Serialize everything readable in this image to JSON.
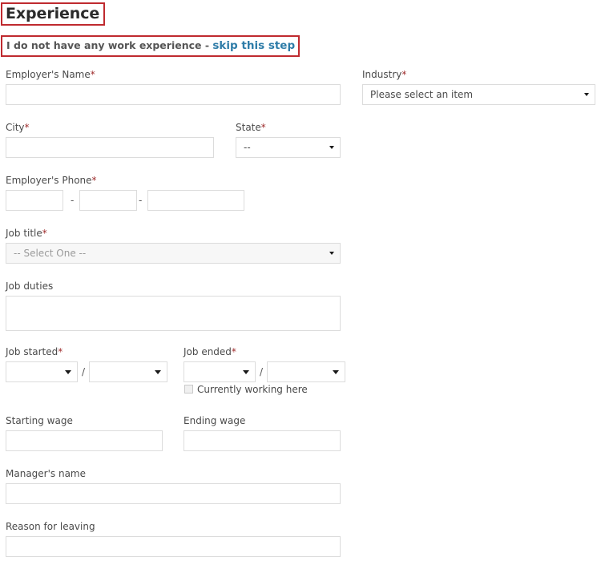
{
  "page": {
    "title": "Experience",
    "highlight_color": "#bf2a2f",
    "link_color": "#2e7ca8",
    "required_marker": "*"
  },
  "skip_banner": {
    "text": "I do not have any work experience - ",
    "link_label": "skip this step"
  },
  "form": {
    "employer_name": {
      "label": "Employer's Name",
      "required": "*",
      "value": "",
      "placeholder": ""
    },
    "industry": {
      "label": "Industry",
      "required": "*",
      "selected": "Please select an item"
    },
    "city": {
      "label": "City",
      "required": "*",
      "value": "",
      "placeholder": ""
    },
    "state": {
      "label": "State",
      "required": "*",
      "selected": "--"
    },
    "employer_phone": {
      "label": "Employer's Phone",
      "required": "*",
      "separator": "-",
      "area_code": "",
      "prefix": "",
      "line_number": ""
    },
    "job_title": {
      "label": "Job title",
      "required": "*",
      "selected": "-- Select One --"
    },
    "job_duties": {
      "label": "Job duties",
      "value": "",
      "placeholder": ""
    },
    "job_started": {
      "label": "Job started",
      "required": "*",
      "separator": "/",
      "month": "",
      "year": ""
    },
    "job_ended": {
      "label": "Job ended",
      "required": "*",
      "separator": "/",
      "month": "",
      "year": ""
    },
    "currently_working": {
      "label": "Currently working here",
      "checked": false
    },
    "starting_wage": {
      "label": "Starting wage",
      "value": ""
    },
    "ending_wage": {
      "label": "Ending wage",
      "value": ""
    },
    "manager_name": {
      "label": "Manager's name",
      "value": ""
    },
    "reason_for_leaving": {
      "label": "Reason for leaving",
      "value": ""
    }
  }
}
